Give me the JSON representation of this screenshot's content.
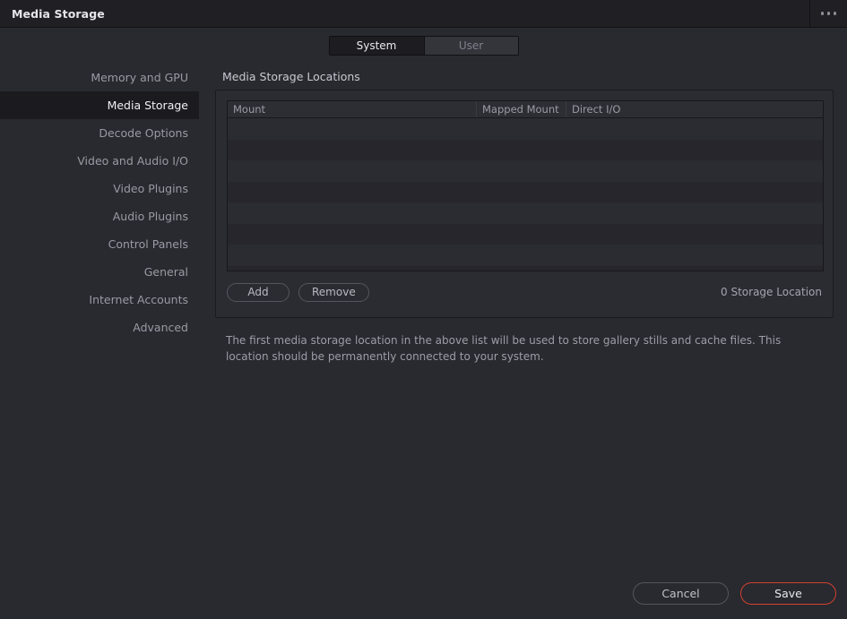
{
  "window": {
    "title": "Media Storage",
    "menu_icon": "ellipsis-icon"
  },
  "tabs": [
    {
      "label": "System",
      "active": true
    },
    {
      "label": "User",
      "active": false
    }
  ],
  "sidebar": {
    "items": [
      {
        "label": "Memory and GPU",
        "active": false
      },
      {
        "label": "Media Storage",
        "active": true
      },
      {
        "label": "Decode Options",
        "active": false
      },
      {
        "label": "Video and Audio I/O",
        "active": false
      },
      {
        "label": "Video Plugins",
        "active": false
      },
      {
        "label": "Audio Plugins",
        "active": false
      },
      {
        "label": "Control Panels",
        "active": false
      },
      {
        "label": "General",
        "active": false
      },
      {
        "label": "Internet Accounts",
        "active": false
      },
      {
        "label": "Advanced",
        "active": false
      }
    ]
  },
  "main": {
    "section_title": "Media Storage Locations",
    "table": {
      "columns": [
        "Mount",
        "Mapped Mount",
        "Direct I/O"
      ],
      "rows": [],
      "empty_row_count": 8
    },
    "panel_footer": {
      "add_label": "Add",
      "remove_label": "Remove",
      "storage_count": "0 Storage Location"
    },
    "description": "The first media storage location in the above list will be used to store gallery stills and cache files. This location should be permanently connected to your system."
  },
  "actions": {
    "cancel_label": "Cancel",
    "save_label": "Save"
  },
  "colors": {
    "window_background": "#292930",
    "titlebar_background": "#1f1f24",
    "panel_background": "#2b2b32",
    "accent_save": "#d1432f",
    "text_primary": "#e8e8ee",
    "text_secondary": "#9a9aa4",
    "row_odd": "#2b2b32",
    "row_even": "#26262c"
  }
}
